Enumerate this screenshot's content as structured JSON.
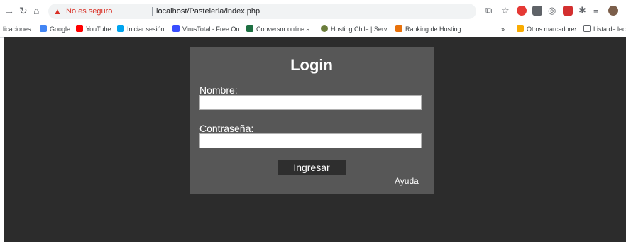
{
  "browser": {
    "security_text": "No es seguro",
    "url": "localhost/Pasteleria/index.php"
  },
  "bookmarks": [
    {
      "label": "licaciones",
      "icon": "apps-icon",
      "color": "#ffffff"
    },
    {
      "label": "Google",
      "icon": "google-icon",
      "color": "#4285f4"
    },
    {
      "label": "YouTube",
      "icon": "youtube-icon",
      "color": "#ff0000"
    },
    {
      "label": "Iniciar sesión",
      "icon": "microsoft-icon",
      "color": "#00a4ef"
    },
    {
      "label": "VirusTotal - Free On...",
      "icon": "virustotal-icon",
      "color": "#394eff"
    },
    {
      "label": "Conversor online a...",
      "icon": "excel-icon",
      "color": "#1d6f42"
    },
    {
      "label": "Hosting Chile | Serv...",
      "icon": "hosting-icon",
      "color": "#6b7d3b"
    },
    {
      "label": "Ranking de Hosting...",
      "icon": "ranking-icon",
      "color": "#e8710a"
    }
  ],
  "bookmarks_right": {
    "more": "»",
    "other": "Otros marcadores",
    "reading": "Lista de lec"
  },
  "login": {
    "title": "Login",
    "name_label": "Nombre:",
    "name_value": "",
    "password_label": "Contraseña:",
    "password_value": "",
    "submit_label": "Ingresar",
    "help_link": "Ayuda"
  },
  "colors": {
    "page_bg": "#2c2c2c",
    "panel_bg": "#575757",
    "button_bg": "#2e2e2e"
  }
}
